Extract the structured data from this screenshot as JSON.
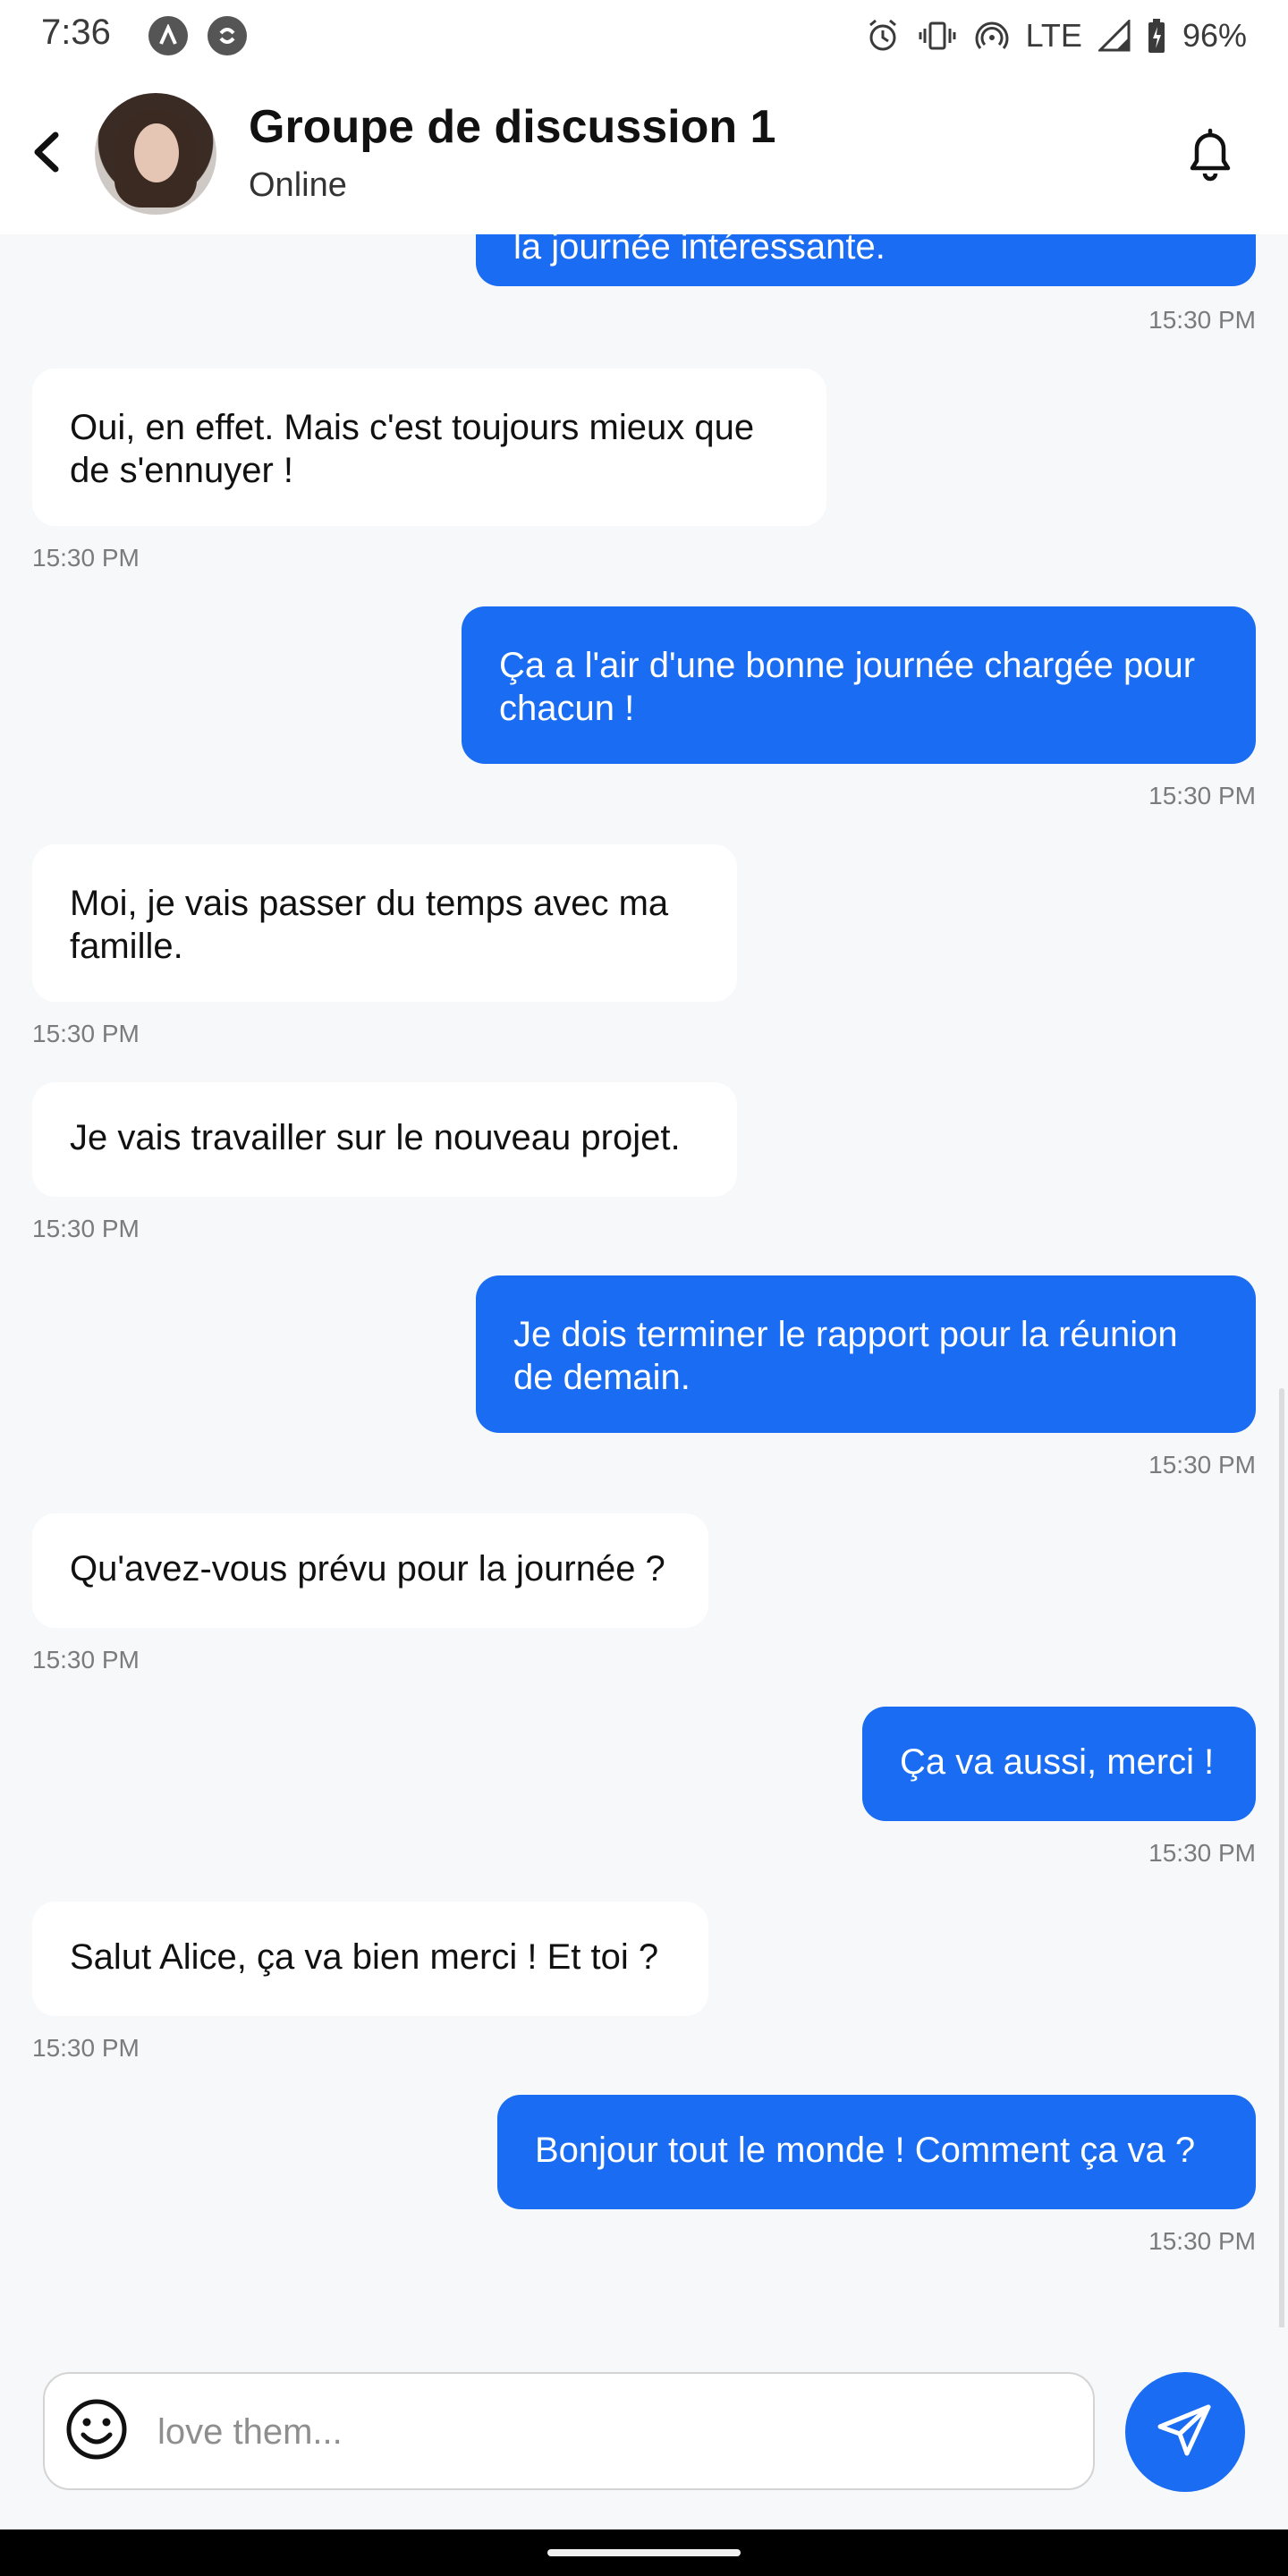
{
  "status_bar": {
    "time": "7:36",
    "network": "LTE",
    "battery": "96%"
  },
  "header": {
    "title": "Groupe de discussion 1",
    "status": "Online"
  },
  "messages": [
    {
      "direction": "out",
      "text": "la journée intéressante.",
      "time": "15:30 PM"
    },
    {
      "direction": "in",
      "text": "Oui, en effet. Mais c'est toujours mieux que de s'ennuyer !",
      "time": "15:30 PM"
    },
    {
      "direction": "out",
      "text": "Ça a l'air d'une bonne journée chargée pour chacun !",
      "time": "15:30 PM"
    },
    {
      "direction": "in",
      "text": "Moi, je vais passer du temps avec ma famille.",
      "time": "15:30 PM"
    },
    {
      "direction": "in",
      "text": "Je vais travailler sur le nouveau projet.",
      "time": "15:30 PM"
    },
    {
      "direction": "out",
      "text": "Je dois terminer le rapport pour la réunion de demain.",
      "time": "15:30 PM"
    },
    {
      "direction": "in",
      "text": "Qu'avez-vous prévu pour la journée ?",
      "time": "15:30 PM"
    },
    {
      "direction": "out",
      "text": "Ça va aussi, merci !",
      "time": "15:30 PM"
    },
    {
      "direction": "in",
      "text": "Salut Alice, ça va bien merci ! Et toi ?",
      "time": "15:30 PM"
    },
    {
      "direction": "out",
      "text": "Bonjour tout le monde ! Comment ça va ?",
      "time": "15:30 PM"
    }
  ],
  "composer": {
    "placeholder": "love them...",
    "value": ""
  },
  "colors": {
    "accent": "#1a6cf2",
    "background": "#f7f8fa",
    "incoming_bubble": "#ffffff",
    "timestamp": "#7b7b7b"
  },
  "icons": {
    "back": "chevron-left-icon",
    "notifications": "bell-icon",
    "emoji": "smiley-icon",
    "send": "paper-plane-icon"
  }
}
